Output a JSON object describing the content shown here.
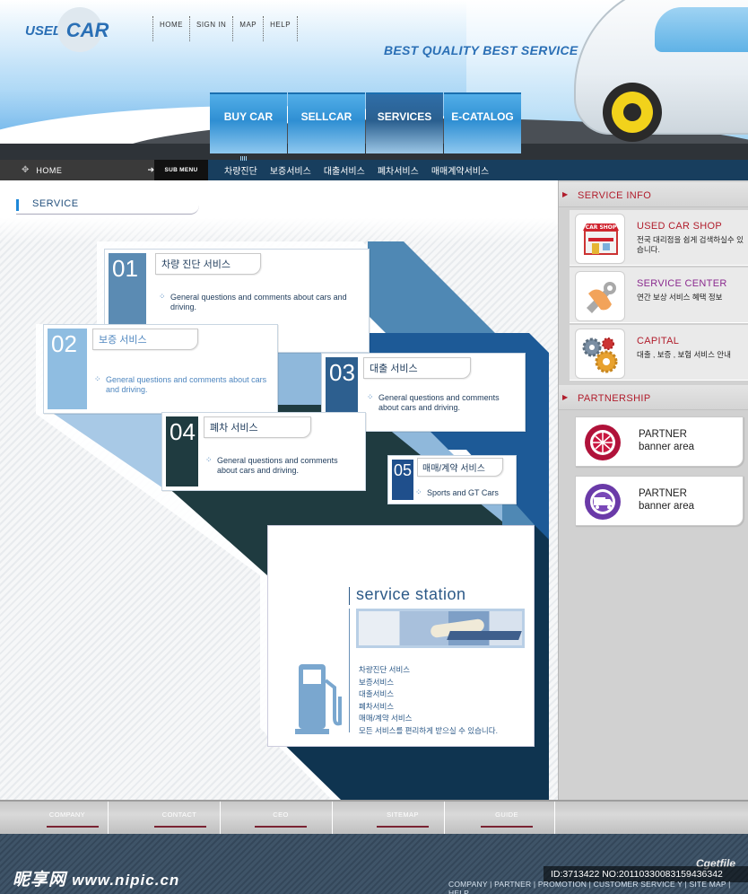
{
  "header": {
    "logo_used": "USED",
    "logo_car": "CAR",
    "top_links": [
      "HOME",
      "SIGN IN",
      "MAP",
      "HELP"
    ],
    "tagline": "BEST QUALITY BEST SERVICE",
    "main_nav": [
      "BUY CAR",
      "SELLCAR",
      "SERVICES",
      "E-CATALOG"
    ],
    "active_nav": "SERVICES"
  },
  "subbar": {
    "home_label": "HOME",
    "sub_menu_label": "SUB MENU",
    "items": [
      "차량진단",
      "보증서비스",
      "대출서비스",
      "폐차서비스",
      "매매계약서비스"
    ]
  },
  "content": {
    "section_title": "SERVICE",
    "cards": [
      {
        "num": "01",
        "title": "차량 진단 서비스",
        "desc": "General questions and comments about cars and driving."
      },
      {
        "num": "02",
        "title": "보증 서비스",
        "desc": "General questions and comments about cars and driving."
      },
      {
        "num": "03",
        "title": "대출 서비스",
        "desc": "General questions and comments about cars and driving."
      },
      {
        "num": "04",
        "title": "폐차 서비스",
        "desc": "General questions and comments about cars and driving."
      },
      {
        "num": "05",
        "title": "매매/계약 서비스",
        "desc": "Sports and GT Cars"
      }
    ],
    "station": {
      "title": "service station",
      "links": [
        "차량진단 서비스",
        "보증서비스",
        "대출서비스",
        "폐차서비스",
        "매매/계약 서비스",
        "모든 서비스를 편리하게 받으실 수 있습니다."
      ]
    }
  },
  "sidebar": {
    "service_info_title": "SERVICE INFO",
    "items": [
      {
        "name": "USED CAR SHOP",
        "desc": "전국 대리점을 쉽게 검색하실수 있습니다.",
        "icon_text": "CAR SHOP",
        "color": "#b11d2c"
      },
      {
        "name": "SERVICE CENTER",
        "desc": "연간 보상 서비스 혜택 정보",
        "color": "#8a2a8e"
      },
      {
        "name": "CAPITAL",
        "desc": "대출 , 보증 , 보험 서비스 안내",
        "color": "#b11d2c"
      }
    ],
    "partnership_title": "PARTNERSHIP",
    "partners": [
      {
        "line1": "PARTNER",
        "line2": "banner area",
        "color": "#b0123a"
      },
      {
        "line1": "PARTNER",
        "line2": "banner area",
        "color": "#6a3aa8"
      }
    ]
  },
  "footer": {
    "nav": [
      "COMPANY",
      "CONTACT",
      "CEO",
      "SITEMAP",
      "GUIDE"
    ],
    "copyright": "COMPANY | PARTNER | PROMOTION | CUSTOMER SERVICE Y | SITE MAP | HELP",
    "watermark_cn": "昵享网",
    "watermark_url": "www.nipic.cn",
    "id_text": "ID:3713422 NO:20110330083159436342",
    "getfile": "Cgetfile"
  },
  "colors": {
    "accent_blue": "#2a6fb5",
    "nav_blue": "#2f8fd3",
    "sidebar_red": "#b11d2c",
    "dark_navy": "#183e5e"
  }
}
